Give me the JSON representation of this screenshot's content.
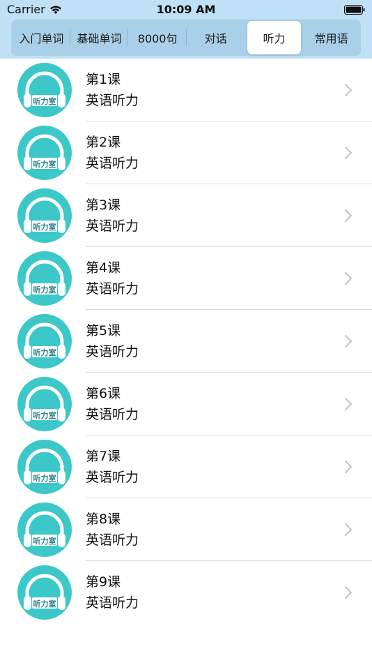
{
  "status_bar": {
    "carrier": "Carrier",
    "time": "10:09 AM"
  },
  "tabs": [
    {
      "label": "入门单词",
      "active": false
    },
    {
      "label": "基础单词",
      "active": false
    },
    {
      "label": "8000句",
      "active": false
    },
    {
      "label": "对话",
      "active": false
    },
    {
      "label": "听力",
      "active": true
    },
    {
      "label": "常用语",
      "active": false
    }
  ],
  "lessons": [
    {
      "title": "第1课",
      "subtitle": "英语听力",
      "icon_text": "听力室"
    },
    {
      "title": "第2课",
      "subtitle": "英语听力",
      "icon_text": "听力室"
    },
    {
      "title": "第3课",
      "subtitle": "英语听力",
      "icon_text": "听力室"
    },
    {
      "title": "第4课",
      "subtitle": "英语听力",
      "icon_text": "听力室"
    },
    {
      "title": "第5课",
      "subtitle": "英语听力",
      "icon_text": "听力室"
    },
    {
      "title": "第6课",
      "subtitle": "英语听力",
      "icon_text": "听力室"
    },
    {
      "title": "第7课",
      "subtitle": "英语听力",
      "icon_text": "听力室"
    },
    {
      "title": "第8课",
      "subtitle": "英语听力",
      "icon_text": "听力室"
    },
    {
      "title": "第9课",
      "subtitle": "英语听力",
      "icon_text": "听力室"
    }
  ],
  "colors": {
    "header_bg": "#bfe0f5",
    "segment_bg": "#a9cfe9",
    "icon_teal": "#3cc8c8",
    "chevron": "#c4c4c9"
  },
  "icons": {
    "wifi": "wifi-icon",
    "battery": "battery-icon",
    "lesson": "headphones-icon",
    "disclosure": "chevron-right-icon"
  }
}
